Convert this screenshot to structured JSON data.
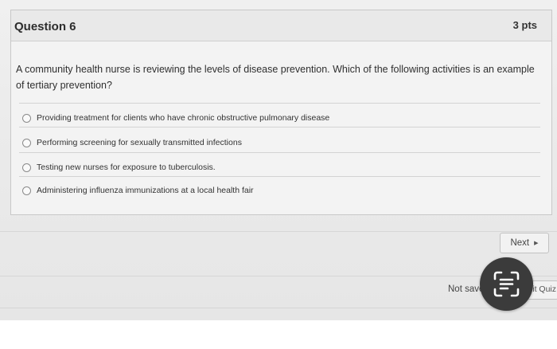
{
  "question": {
    "title": "Question 6",
    "points": "3 pts",
    "text": "A community health nurse is reviewing the levels of disease prevention. Which of the following activities is an example of tertiary prevention?",
    "answers": [
      "Providing treatment for clients who have chronic obstructive pulmonary disease",
      "Performing screening for sexually transmitted infections",
      "Testing new nurses for exposure to tuberculosis.",
      "Administering influenza immunizations at a local health fair"
    ]
  },
  "navigation": {
    "next_label": "Next",
    "next_icon": "triangle-right-icon"
  },
  "footer": {
    "status_text": "Not saved",
    "submit_label": "Submit Quiz"
  },
  "overlay": {
    "icon": "text-scan-icon"
  }
}
